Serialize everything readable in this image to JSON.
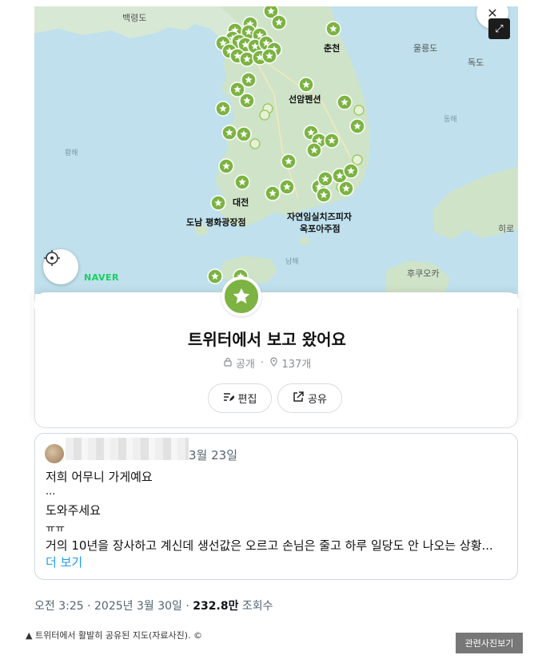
{
  "map": {
    "labels": {
      "baengnyeongdo": "백령도",
      "chuncheon": "춘천",
      "ulleungdo": "울릉도",
      "dokdo": "독도",
      "seonampension": "선암펜션",
      "donghae": "동해",
      "hwanghae": "황해",
      "daejeon": "대전",
      "donam": "도남 평화광장점",
      "jayeon_line1": "자연임실치즈피자",
      "jayeon_line2": "옥포아주점",
      "namhae": "남해",
      "fukuoka": "후쿠오카",
      "hiroshima": "히로"
    },
    "provider_logo": "NAVER",
    "fullscreen_icon": "expand-icon",
    "close_icon": "close-icon"
  },
  "list_card": {
    "title": "트위터에서 보고 왔어요",
    "visibility": "공개",
    "place_count": "137개",
    "edit_label": "편집",
    "share_label": "공유",
    "accent_color": "#7cb342"
  },
  "tweet": {
    "date": "3월 23일",
    "lines": [
      "저희 어무니 가게예요",
      "...",
      "도와주세요",
      "ㅠㅠ",
      "거의 10년을 장사하고 계신데 생선값은 오르고 손님은 줄고 하루 일당도 안 나오는 상황..."
    ],
    "more_label": "더 보기",
    "more_color": "#1d9bf0"
  },
  "stats": {
    "time": "오전 3:25",
    "date": "2025년 3월 30일",
    "views": "232.8만",
    "views_label": "조회수"
  },
  "caption": {
    "text": "▲ 트위터에서 활발히 공유된 지도(자료사진). ©",
    "related_button": "관련사진보기"
  }
}
